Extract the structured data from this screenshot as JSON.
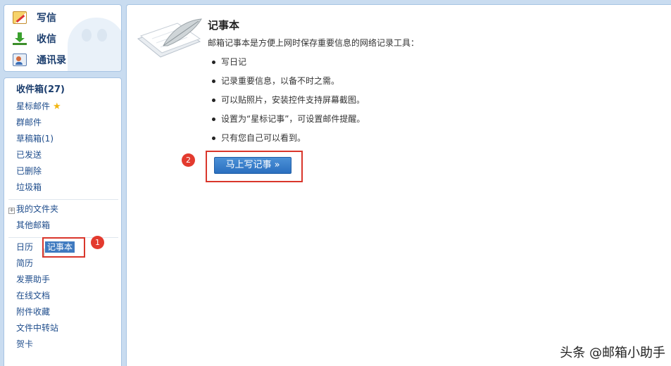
{
  "sidebar": {
    "actions": {
      "write": "写信",
      "inbox": "收信",
      "contacts": "通讯录"
    },
    "folders": {
      "inbox": "收件箱(27)",
      "starred": "星标邮件",
      "group": "群邮件",
      "drafts": "草稿箱(1)",
      "sent": "已发送",
      "deleted": "已删除",
      "spam": "垃圾箱"
    },
    "my_folders": "我的文件夹",
    "other_mailboxes": "其他邮箱",
    "tools": {
      "calendar": "日历",
      "notebook": "记事本",
      "resume": "简历",
      "invoice": "发票助手",
      "docs": "在线文档",
      "attachments": "附件收藏",
      "transfer": "文件中转站",
      "cards": "贺卡"
    }
  },
  "main": {
    "title": "记事本",
    "description": "邮箱记事本是方便上网时保存重要信息的网络记录工具：",
    "features": [
      "写日记",
      "记录重要信息，以备不时之需。",
      "可以贴照片，安装控件支持屏幕截图。",
      "设置为“星标记事”，可设置邮件提醒。",
      "只有您自己可以看到。"
    ],
    "write_button": "马上写记事 »"
  },
  "annotations": {
    "step1": "1",
    "step2": "2"
  },
  "watermark": "头条 @邮箱小助手",
  "colors": {
    "accent": "#3f7ac0",
    "annotation": "#d9362b"
  }
}
